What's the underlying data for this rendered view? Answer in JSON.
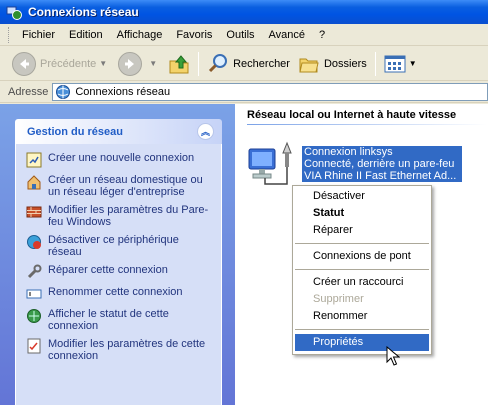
{
  "window": {
    "title": "Connexions réseau"
  },
  "menu": [
    "Fichier",
    "Edition",
    "Affichage",
    "Favoris",
    "Outils",
    "Avancé",
    "?"
  ],
  "toolbar": {
    "back_label": "Précédente",
    "search_label": "Rechercher",
    "folders_label": "Dossiers"
  },
  "address": {
    "label": "Adresse",
    "value": "Connexions réseau"
  },
  "tasks": {
    "header": "Gestion du réseau",
    "items": [
      {
        "label": "Créer une nouvelle connexion",
        "icon": "new-connection-icon"
      },
      {
        "label": "Créer un réseau domestique ou un réseau léger d'entreprise",
        "icon": "home-network-icon"
      },
      {
        "label": "Modifier les paramètres du Pare-feu Windows",
        "icon": "firewall-icon"
      },
      {
        "label": "Désactiver ce périphérique réseau",
        "icon": "disable-device-icon"
      },
      {
        "label": "Réparer cette connexion",
        "icon": "repair-icon"
      },
      {
        "label": "Renommer cette connexion",
        "icon": "rename-icon"
      },
      {
        "label": "Afficher le statut de cette connexion",
        "icon": "status-icon"
      },
      {
        "label": "Modifier les paramètres de cette connexion",
        "icon": "settings-icon"
      }
    ]
  },
  "group": {
    "header": "Réseau local ou Internet à haute vitesse"
  },
  "connection": {
    "name": "Connexion linksys",
    "status": "Connecté, derrière un pare-feu",
    "device": "VIA Rhine II Fast Ethernet Ad..."
  },
  "context_menu": [
    {
      "label": "Désactiver"
    },
    {
      "label": "Statut",
      "bold": true
    },
    {
      "label": "Réparer"
    },
    {
      "separator": true
    },
    {
      "label": "Connexions de pont"
    },
    {
      "separator": true
    },
    {
      "label": "Créer un raccourci"
    },
    {
      "label": "Supprimer",
      "disabled": true
    },
    {
      "label": "Renommer"
    },
    {
      "separator": true
    },
    {
      "label": "Propriétés",
      "selected": true
    }
  ],
  "colors": {
    "selection": "#316ac5",
    "task_link": "#21347d",
    "task_header": "#215dc6"
  }
}
